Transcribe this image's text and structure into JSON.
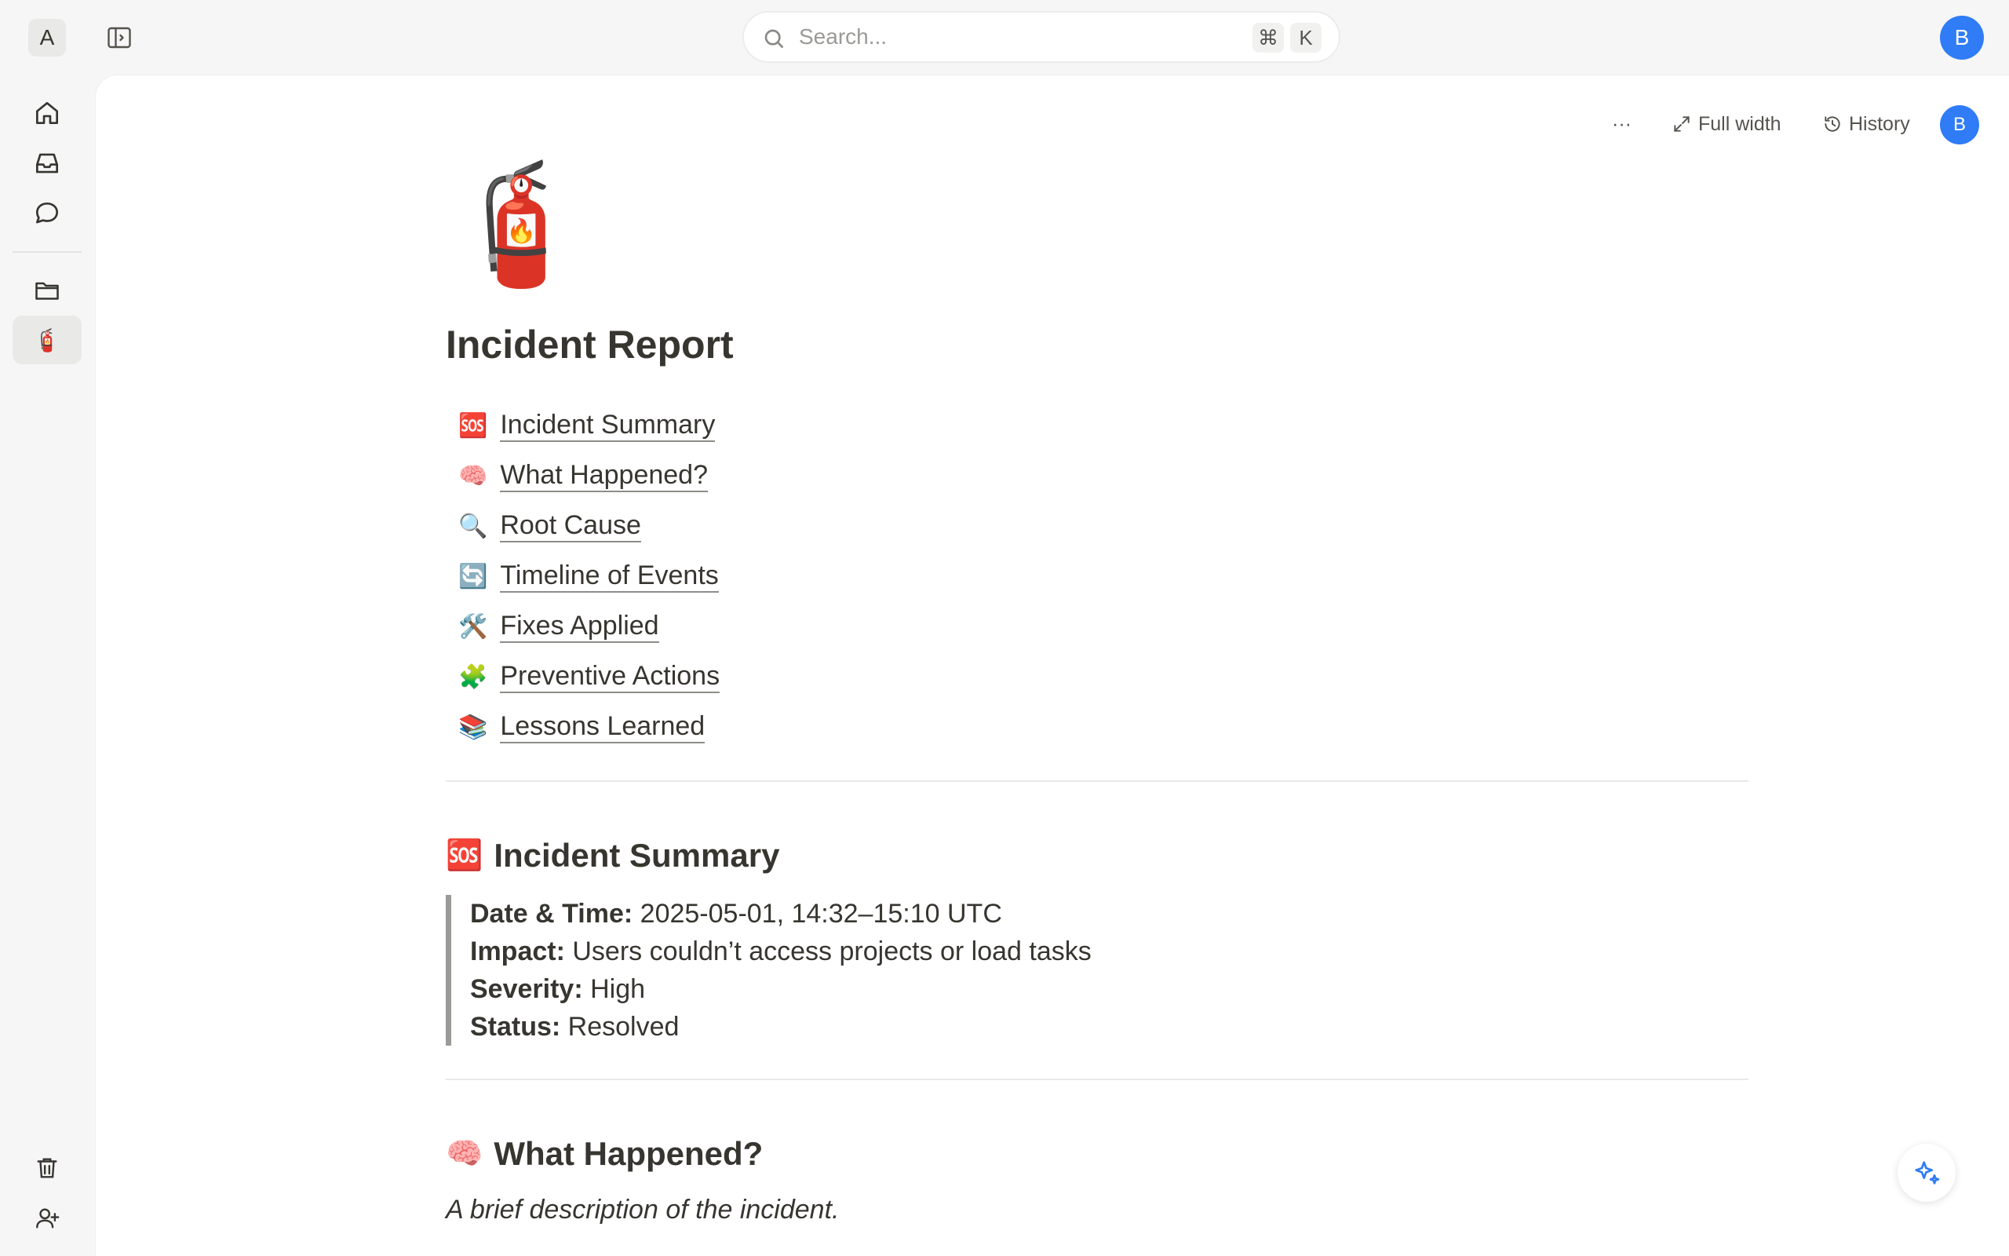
{
  "workspace": {
    "initial": "A"
  },
  "search": {
    "placeholder": "Search...",
    "shortcut_mod": "⌘",
    "shortcut_key": "K"
  },
  "user": {
    "initial": "B"
  },
  "toolbar": {
    "more_label": "···",
    "full_width_label": "Full width",
    "history_label": "History"
  },
  "page": {
    "icon": "🧯",
    "title": "Incident Report",
    "toc": [
      {
        "emoji": "🆘",
        "label": "Incident Summary"
      },
      {
        "emoji": "🧠",
        "label": "What Happened?"
      },
      {
        "emoji": "🔍",
        "label": "Root Cause"
      },
      {
        "emoji": "🔄",
        "label": "Timeline of Events"
      },
      {
        "emoji": "🛠️",
        "label": "Fixes Applied"
      },
      {
        "emoji": "🧩",
        "label": "Preventive Actions"
      },
      {
        "emoji": "📚",
        "label": "Lessons Learned"
      }
    ],
    "summary": {
      "emoji": "🆘",
      "heading": "Incident Summary",
      "rows": [
        {
          "key": "Date & Time:",
          "value": " 2025-05-01, 14:32–15:10 UTC"
        },
        {
          "key": "Impact:",
          "value": " Users couldn’t access projects or load tasks"
        },
        {
          "key": "Severity:",
          "value": " High"
        },
        {
          "key": "Status:",
          "value": " Resolved"
        }
      ]
    },
    "what_happened": {
      "emoji": "🧠",
      "heading": "What Happened?",
      "description": "A brief description of the incident."
    }
  },
  "colors": {
    "accent": "#2f7cf6",
    "text": "#37352f",
    "background": "#f6f6f6"
  }
}
